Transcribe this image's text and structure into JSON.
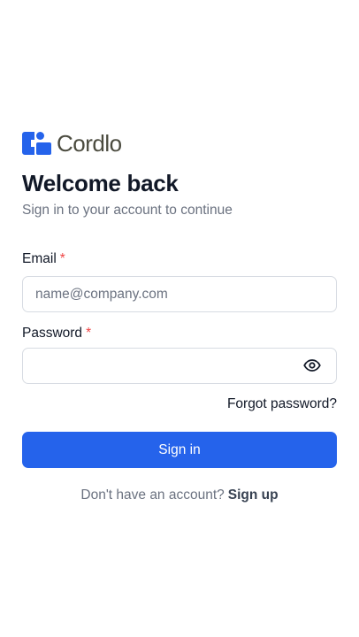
{
  "brand": {
    "name": "Cordlo",
    "logo_icon": "cordlo-logo-icon",
    "logo_color": "#2563eb"
  },
  "header": {
    "title": "Welcome back",
    "subtitle": "Sign in to your account to continue"
  },
  "form": {
    "email": {
      "label": "Email",
      "required_marker": "*",
      "placeholder": "name@company.com",
      "value": ""
    },
    "password": {
      "label": "Password",
      "required_marker": "*",
      "value": "",
      "toggle_icon": "eye-icon"
    },
    "forgot_password_label": "Forgot password?",
    "submit_label": "Sign in"
  },
  "footer": {
    "prompt": "Don't have an account?",
    "signup_label": "Sign up"
  },
  "colors": {
    "primary": "#2563eb",
    "required": "#ef4444",
    "muted_text": "#6b7280",
    "border": "#d7dbe2"
  }
}
